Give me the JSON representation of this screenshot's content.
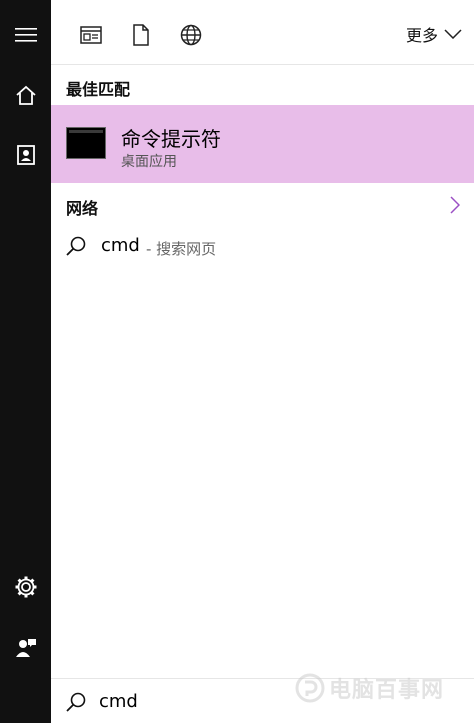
{
  "sidebar": {
    "items": [
      {
        "icon": "menu-icon"
      },
      {
        "icon": "home-icon"
      },
      {
        "icon": "notebook-icon"
      },
      {
        "icon": "gear-icon"
      },
      {
        "icon": "feedback-icon"
      }
    ]
  },
  "topbar": {
    "filters": [
      {
        "icon": "apps-filter-icon"
      },
      {
        "icon": "documents-filter-icon"
      },
      {
        "icon": "web-filter-icon"
      }
    ],
    "more_label": "更多"
  },
  "best_match": {
    "section_title": "最佳匹配",
    "title": "命令提示符",
    "subtitle": "桌面应用"
  },
  "web": {
    "section_title": "网络",
    "query": "cmd",
    "suffix": "- 搜索网页"
  },
  "search": {
    "value": "cmd"
  },
  "watermark": {
    "text": "电脑百事网",
    "url": "WWW.PC841.COM"
  },
  "colors": {
    "sidebar_bg": "#111111",
    "highlight": "#e8bde9",
    "accent": "#9b4fc4"
  }
}
